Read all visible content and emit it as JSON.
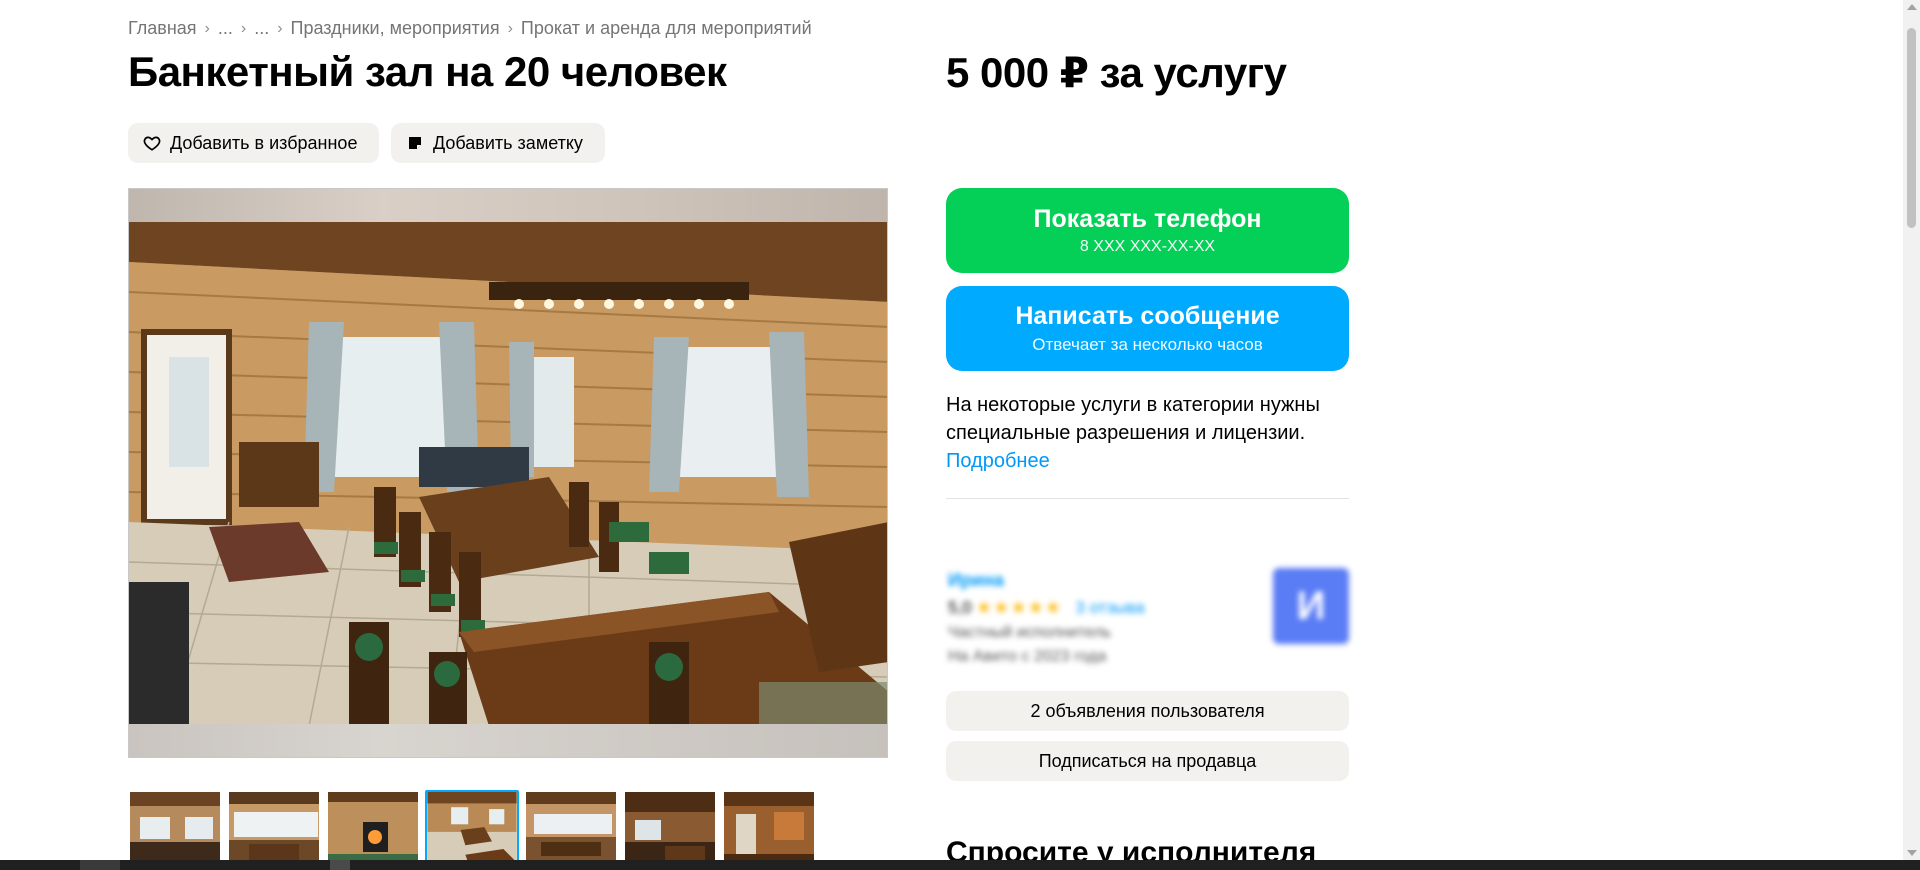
{
  "breadcrumb": {
    "items": [
      "Главная",
      "...",
      "...",
      "Праздники, мероприятия",
      "Прокат и аренда для мероприятий"
    ],
    "separator": "›"
  },
  "listing": {
    "title": "Банкетный зал на 20 человек",
    "price": "5 000 ₽ за услугу"
  },
  "actions": {
    "favorite_label": "Добавить в избранное",
    "favorite_icon": "heart-icon",
    "note_label": "Добавить заметку",
    "note_icon": "note-icon"
  },
  "gallery": {
    "thumbnail_count": 7,
    "active_index": 3
  },
  "contact": {
    "phone_label": "Показать телефон",
    "phone_masked": "8 XXX XXX-XX-XX",
    "phone_color": "#04cf56",
    "message_label": "Написать сообщение",
    "message_sub": "Отвечает за несколько часов",
    "message_color": "#00aaff"
  },
  "notice": {
    "text": "На некоторые услуги в категории нужны специальные разрешения и лицензии.",
    "more_link": "Подробнее"
  },
  "seller": {
    "name": "Ирина",
    "rating": "5,0",
    "stars": "★★★★★",
    "reviews": "3 отзыва",
    "type": "Частный исполнитель",
    "since": "На Авито с 2023 года",
    "avatar_letter": "И",
    "avatar_color": "#5a7cf5"
  },
  "seller_actions": {
    "ads_label": "2 объявления пользователя",
    "subscribe_label": "Подписаться на продавца"
  },
  "ask": {
    "heading": "Спросите у исполнителя"
  }
}
